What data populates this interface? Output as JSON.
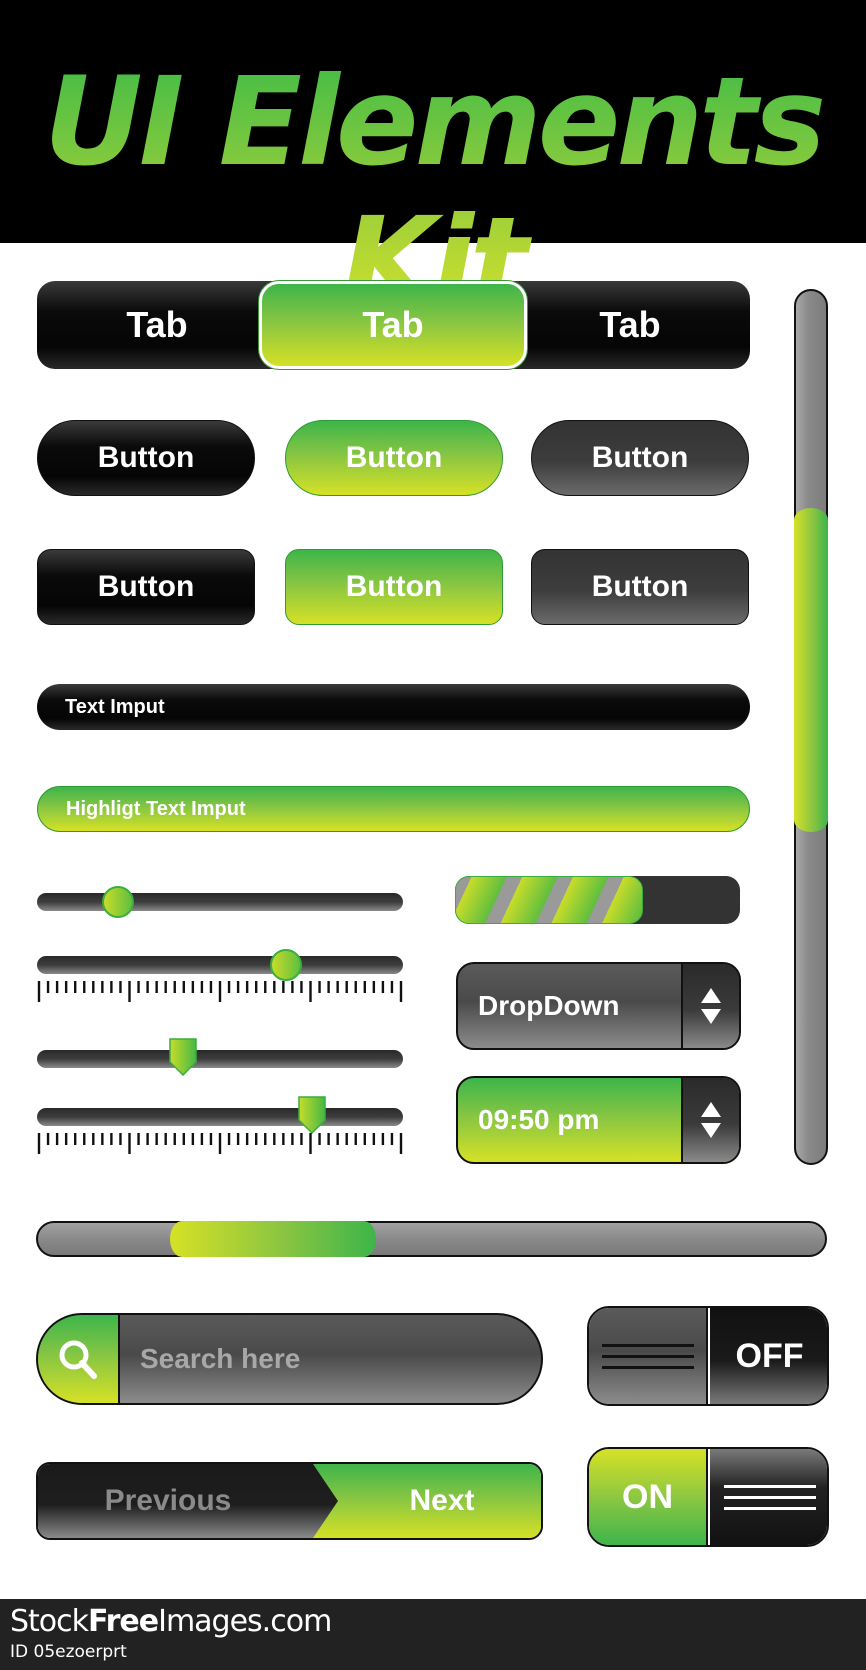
{
  "header": {
    "title": "UI Elements Kit"
  },
  "tabs": [
    {
      "label": "Tab",
      "active": false
    },
    {
      "label": "Tab",
      "active": true
    },
    {
      "label": "Tab",
      "active": false
    }
  ],
  "buttons": {
    "pill": [
      {
        "label": "Button",
        "style": "black"
      },
      {
        "label": "Button",
        "style": "green"
      },
      {
        "label": "Button",
        "style": "dark-grey"
      }
    ],
    "rounded": [
      {
        "label": "Button",
        "style": "black"
      },
      {
        "label": "Button",
        "style": "green"
      },
      {
        "label": "Button",
        "style": "dark-grey"
      }
    ]
  },
  "inputs": {
    "text_input": {
      "value": "Text Imput"
    },
    "highlight_input": {
      "value": "Highligt Text Imput"
    }
  },
  "sliders": [
    {
      "type": "round-knob",
      "value": 0.22,
      "ruler": false
    },
    {
      "type": "round-knob",
      "value": 0.68,
      "ruler": true
    },
    {
      "type": "arrow-knob",
      "value": 0.4,
      "ruler": false
    },
    {
      "type": "arrow-knob",
      "value": 0.75,
      "ruler": true
    }
  ],
  "ruler": {
    "minor_ticks": 40,
    "major_every": 10
  },
  "progress": {
    "value": 0.66
  },
  "dropdown": {
    "value": "DropDown"
  },
  "time_picker": {
    "value": "09:50 pm"
  },
  "vertical_scrollbar": {
    "thumb_start": 0.25,
    "thumb_size": 0.37
  },
  "horizontal_scrollbar": {
    "thumb_start": 0.17,
    "thumb_size": 0.26
  },
  "search": {
    "placeholder": "Search here",
    "icon": "search-icon"
  },
  "toggle_off": {
    "label": "OFF",
    "state": false
  },
  "toggle_on": {
    "label": "ON",
    "state": true
  },
  "pager": {
    "previous_label": "Previous",
    "next_label": "Next"
  },
  "footer": {
    "brand_prefix": "Stock",
    "brand_bold": "Free",
    "brand_suffix": "Images.com",
    "image_id": "ID 05ezoerprt"
  },
  "colors": {
    "accent_green": "#3db54a",
    "accent_yellow": "#d6e126",
    "black": "#050505",
    "dark_grey": "#3d3d3d",
    "grey": "#8a8a8a"
  }
}
